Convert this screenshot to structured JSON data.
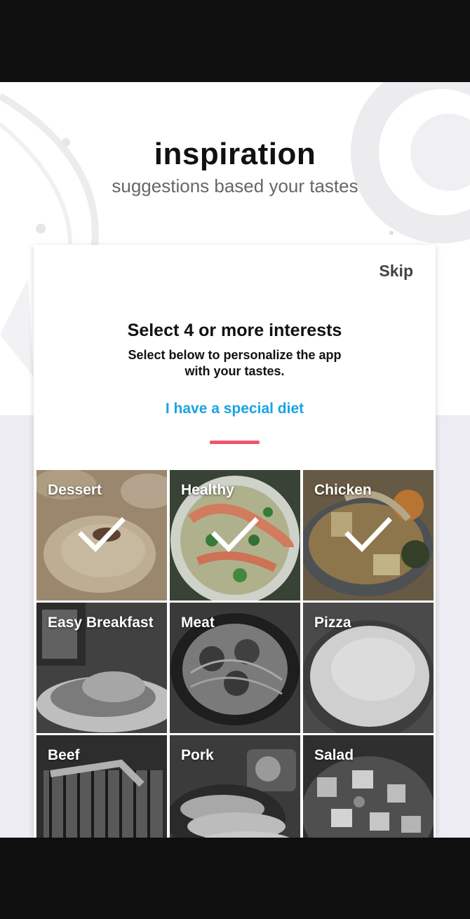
{
  "header": {
    "title": "inspiration",
    "subtitle": "suggestions based your tastes"
  },
  "card": {
    "skip_label": "Skip",
    "title": "Select 4 or more interests",
    "description": "Select below to personalize the app with your tastes.",
    "diet_link": "I have a special diet"
  },
  "colors": {
    "accent_line": "#f0566a",
    "link": "#19a4e0"
  },
  "interests": [
    {
      "label": "Dessert",
      "selected": true,
      "icon": "dessert-photo"
    },
    {
      "label": "Healthy",
      "selected": true,
      "icon": "healthy-photo"
    },
    {
      "label": "Chicken",
      "selected": true,
      "icon": "chicken-photo"
    },
    {
      "label": "Easy Breakfast",
      "selected": false,
      "icon": "breakfast-photo"
    },
    {
      "label": "Meat",
      "selected": false,
      "icon": "meat-photo"
    },
    {
      "label": "Pizza",
      "selected": false,
      "icon": "pizza-photo"
    },
    {
      "label": "Beef",
      "selected": false,
      "icon": "beef-photo"
    },
    {
      "label": "Pork",
      "selected": false,
      "icon": "pork-photo"
    },
    {
      "label": "Salad",
      "selected": false,
      "icon": "salad-photo"
    }
  ]
}
